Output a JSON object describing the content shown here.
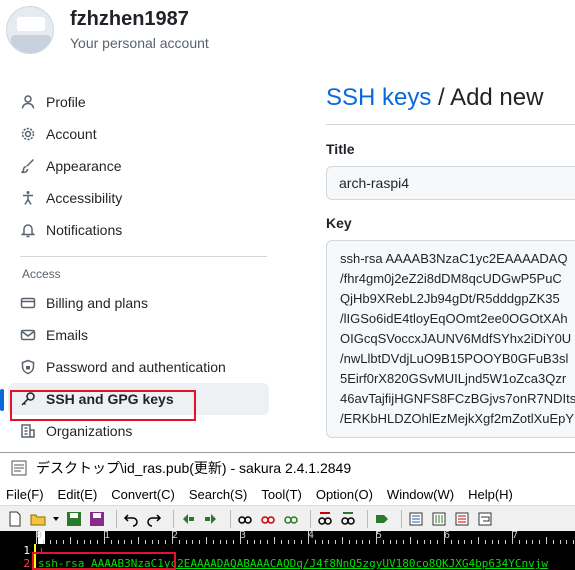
{
  "profile": {
    "username": "fzhzhen1987",
    "subtitle": "Your personal account"
  },
  "sidebar": {
    "items": [
      {
        "label": "Profile",
        "icon": "person-icon"
      },
      {
        "label": "Account",
        "icon": "gear-icon"
      },
      {
        "label": "Appearance",
        "icon": "paintbrush-icon"
      },
      {
        "label": "Accessibility",
        "icon": "accessibility-icon"
      },
      {
        "label": "Notifications",
        "icon": "bell-icon"
      }
    ],
    "access_label": "Access",
    "access_items": [
      {
        "label": "Billing and plans",
        "icon": "credit-card-icon"
      },
      {
        "label": "Emails",
        "icon": "mail-icon"
      },
      {
        "label": "Password and authentication",
        "icon": "shield-lock-icon"
      },
      {
        "label": "SSH and GPG keys",
        "icon": "key-icon",
        "active": true
      },
      {
        "label": "Organizations",
        "icon": "organization-icon"
      }
    ]
  },
  "main": {
    "breadcrumb_link": "SSH keys",
    "breadcrumb_sep": " / ",
    "breadcrumb_current": "Add new",
    "title_label": "Title",
    "title_value": "arch-raspi4",
    "key_label": "Key",
    "key_lines": [
      "ssh-rsa AAAAB3NzaC1yc2EAAAADAQ",
      "/fhr4gm0j2eZ2i8dDM8qcUDGwP5PuC",
      "QjHb9XRebL2Jb94gDt/R5dddgpZK35",
      "/lIGSo6idE4tloyEqOOmt2ee0OGOtXAh",
      "OIGcqSVoccxJAUNV6MdfSYhx2iDiY0U",
      "/nwLlbtDVdjLuO9B15POOYB0GFuB3sl",
      "5Eirf0rX820GSvMUILjnd5W1oZca3Qzr",
      "46avTajfijHGNFS8FCzBGjvs7onR7NDIts",
      "/ERKbHLDZOhlEzMejkXgf2mZotlXuEpY"
    ]
  },
  "editor": {
    "window_title": "デスクトップ\\id_ras.pub(更新) - sakura 2.4.1.2849",
    "menu": [
      "File(F)",
      "Edit(E)",
      "Convert(C)",
      "Search(S)",
      "Tool(T)",
      "Option(O)",
      "Window(W)",
      "Help(H)"
    ],
    "ruler_numbers": [
      "0",
      "1",
      "2",
      "3",
      "4",
      "5",
      "6",
      "7"
    ],
    "lines": [
      {
        "num": "1",
        "text": "↓"
      },
      {
        "num": "2",
        "text": "ssh-rsa AAAAB3NzaC1yc2EAAAADAQABAAACAQDq/J4f8NnQ5zgyUV180co8QKJXG4bp634YCnvjw"
      }
    ]
  },
  "colors": {
    "link": "#0969da",
    "highlight_box": "#e4112b",
    "editor_text": "#00e000",
    "editor_bg": "#000000"
  }
}
